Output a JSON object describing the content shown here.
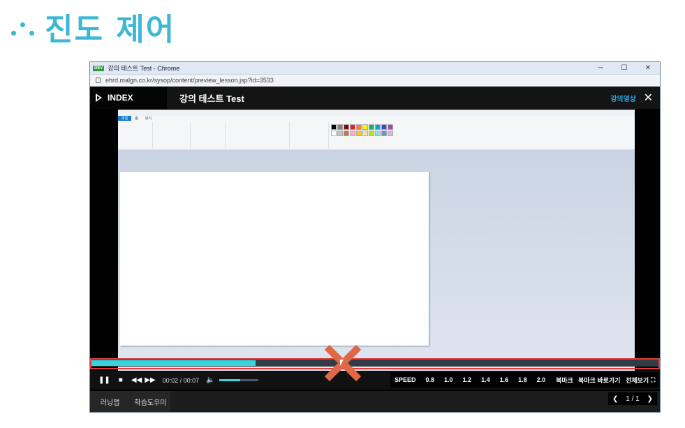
{
  "slide": {
    "title": "진도 제어"
  },
  "browser": {
    "badge": "DEV",
    "window_title": "강의 테스트 Test - Chrome",
    "url": "ehrd.malgn.co.kr/sysop/content/preview_lesson.jsp?id=3533",
    "minimize": "─",
    "maximize": "☐",
    "close": "✕"
  },
  "player": {
    "index_label": "INDEX",
    "lesson_title": "강의 테스트 Test",
    "video_tab": "강의영상",
    "close_icon": "✕",
    "time": "00:02 / 00:07",
    "progress_fraction": 0.29,
    "volume_fraction": 0.55,
    "speed_label": "SPEED",
    "speeds": [
      "0.8",
      "1.0",
      "1.2",
      "1.4",
      "1.6",
      "1.8",
      "2.0"
    ],
    "bookmark": "북마크",
    "bookmark_go": "북마크 바로가기",
    "fullscreen": "전체보기",
    "fullscreen_icon": "⛶",
    "bottom_tabs": [
      "러닝맵",
      "학습도우미"
    ],
    "pager": {
      "prev": "❮",
      "text": "1 / 1",
      "next": "❯"
    }
  },
  "paint": {
    "tabs": [
      "파일",
      "홈",
      "보기"
    ]
  },
  "colors": {
    "accent": "#3bb8d4",
    "progress": "#37d3de",
    "video_tab": "#2aa5e6",
    "frame": "#e33b3b",
    "xmark": "#e06845"
  }
}
